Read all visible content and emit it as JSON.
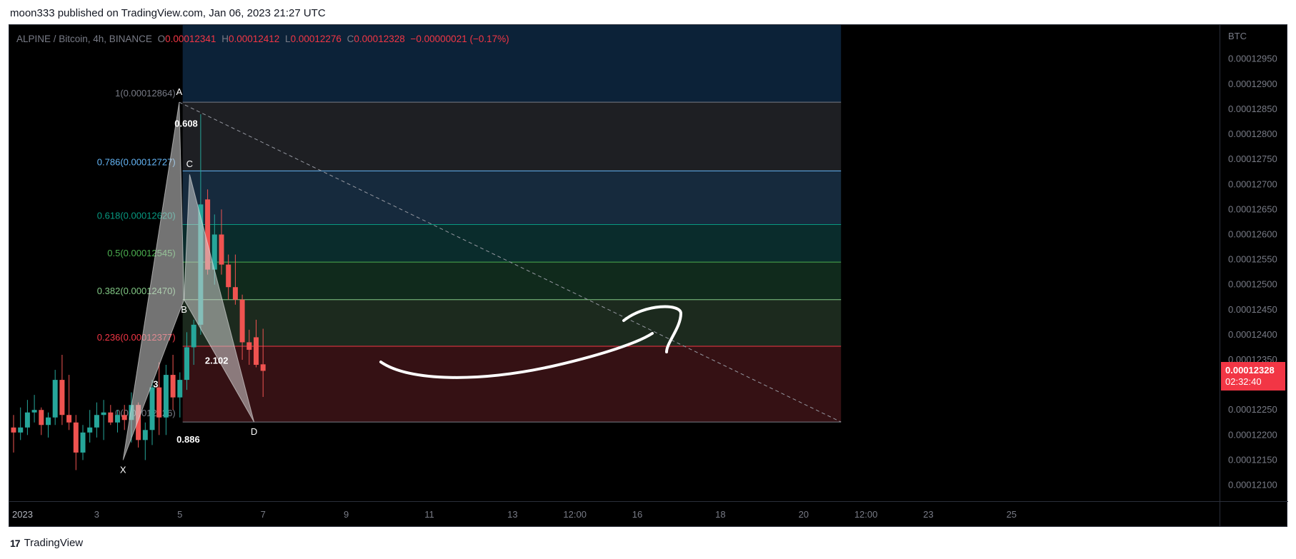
{
  "header": {
    "published_text": "moon333 published on TradingView.com, Jan 06, 2023 21:27 UTC"
  },
  "legend": {
    "symbol": "ALPINE / Bitcoin, 4h, BINANCE",
    "open_label": "O",
    "open": "0.00012341",
    "high_label": "H",
    "high": "0.00012412",
    "low_label": "L",
    "low": "0.00012276",
    "close_label": "C",
    "close": "0.00012328",
    "change": "−0.00000021 (−0.17%)"
  },
  "price_axis": {
    "unit": "BTC",
    "last_price": "0.00012328",
    "countdown": "02:32:40"
  },
  "footer": {
    "brand_name": "TradingView",
    "brand_mark": "17"
  },
  "colors": {
    "up": "#26a69a",
    "down": "#ef5350",
    "axis_text": "#787b86",
    "last_price_bg": "#f23645"
  },
  "chart_data": {
    "type": "candlestick",
    "timeframe": "4h",
    "ylim": [
      0.00012068,
      0.00013018
    ],
    "y_ticks": [
      "0.00012950",
      "0.00012900",
      "0.00012850",
      "0.00012800",
      "0.00012750",
      "0.00012700",
      "0.00012650",
      "0.00012600",
      "0.00012550",
      "0.00012500",
      "0.00012450",
      "0.00012400",
      "0.00012350",
      "0.00012250",
      "0.00012200",
      "0.00012150",
      "0.00012100"
    ],
    "x_ticks": [
      {
        "label": "2023",
        "t": 0
      },
      {
        "label": "3",
        "t": 12
      },
      {
        "label": "5",
        "t": 24
      },
      {
        "label": "7",
        "t": 36
      },
      {
        "label": "9",
        "t": 48
      },
      {
        "label": "11",
        "t": 60
      },
      {
        "label": "13",
        "t": 72
      },
      {
        "label": "12:00",
        "t": 81
      },
      {
        "label": "16",
        "t": 90
      },
      {
        "label": "18",
        "t": 102
      },
      {
        "label": "20",
        "t": 114
      },
      {
        "label": "12:00",
        "t": 123
      },
      {
        "label": "23",
        "t": 132
      },
      {
        "label": "25",
        "t": 144
      }
    ],
    "candles": [
      {
        "t": 0,
        "o": 0.00012215,
        "h": 0.0001224,
        "l": 0.00012165,
        "c": 0.00012205
      },
      {
        "t": 1,
        "o": 0.00012205,
        "h": 0.00012255,
        "l": 0.0001219,
        "c": 0.00012215
      },
      {
        "t": 2,
        "o": 0.00012215,
        "h": 0.0001227,
        "l": 0.000122,
        "c": 0.00012245
      },
      {
        "t": 3,
        "o": 0.00012245,
        "h": 0.0001228,
        "l": 0.00012225,
        "c": 0.0001225
      },
      {
        "t": 4,
        "o": 0.0001225,
        "h": 0.00012255,
        "l": 0.000122,
        "c": 0.0001222
      },
      {
        "t": 5,
        "o": 0.0001222,
        "h": 0.00012245,
        "l": 0.00012195,
        "c": 0.00012235
      },
      {
        "t": 6,
        "o": 0.00012235,
        "h": 0.0001233,
        "l": 0.0001222,
        "c": 0.0001231
      },
      {
        "t": 7,
        "o": 0.0001231,
        "h": 0.0001236,
        "l": 0.0001222,
        "c": 0.0001224
      },
      {
        "t": 8,
        "o": 0.0001224,
        "h": 0.0001232,
        "l": 0.0001221,
        "c": 0.00012225
      },
      {
        "t": 9,
        "o": 0.00012225,
        "h": 0.0001224,
        "l": 0.0001213,
        "c": 0.00012165
      },
      {
        "t": 10,
        "o": 0.00012165,
        "h": 0.0001222,
        "l": 0.0001215,
        "c": 0.00012205
      },
      {
        "t": 11,
        "o": 0.00012205,
        "h": 0.0001225,
        "l": 0.00012185,
        "c": 0.00012215
      },
      {
        "t": 12,
        "o": 0.00012215,
        "h": 0.00012265,
        "l": 0.00012195,
        "c": 0.0001224
      },
      {
        "t": 13,
        "o": 0.0001224,
        "h": 0.0001227,
        "l": 0.0001219,
        "c": 0.00012245
      },
      {
        "t": 14,
        "o": 0.00012245,
        "h": 0.0001226,
        "l": 0.0001222,
        "c": 0.00012225
      },
      {
        "t": 15,
        "o": 0.00012225,
        "h": 0.0001225,
        "l": 0.00012205,
        "c": 0.0001224
      },
      {
        "t": 16,
        "o": 0.0001224,
        "h": 0.0001226,
        "l": 0.0001221,
        "c": 0.0001223
      },
      {
        "t": 17,
        "o": 0.0001223,
        "h": 0.00012285,
        "l": 0.00012185,
        "c": 0.0001226
      },
      {
        "t": 18,
        "o": 0.0001226,
        "h": 0.00012265,
        "l": 0.00012175,
        "c": 0.0001219
      },
      {
        "t": 19,
        "o": 0.0001219,
        "h": 0.00012225,
        "l": 0.0001215,
        "c": 0.0001221
      },
      {
        "t": 20,
        "o": 0.0001221,
        "h": 0.0001231,
        "l": 0.0001218,
        "c": 0.00012295
      },
      {
        "t": 21,
        "o": 0.00012295,
        "h": 0.00012345,
        "l": 0.000122,
        "c": 0.00012235
      },
      {
        "t": 22,
        "o": 0.00012235,
        "h": 0.0001234,
        "l": 0.000122,
        "c": 0.0001232
      },
      {
        "t": 23,
        "o": 0.0001232,
        "h": 0.0001236,
        "l": 0.0001225,
        "c": 0.00012275
      },
      {
        "t": 24,
        "o": 0.00012275,
        "h": 0.00012325,
        "l": 0.00012235,
        "c": 0.0001231
      },
      {
        "t": 25,
        "o": 0.0001231,
        "h": 0.00012405,
        "l": 0.0001229,
        "c": 0.00012375
      },
      {
        "t": 26,
        "o": 0.00012375,
        "h": 0.0001243,
        "l": 0.0001234,
        "c": 0.0001242
      },
      {
        "t": 27,
        "o": 0.0001242,
        "h": 0.0001284,
        "l": 0.000124,
        "c": 0.0001266
      },
      {
        "t": 28,
        "o": 0.0001267,
        "h": 0.0001269,
        "l": 0.0001252,
        "c": 0.0001253
      },
      {
        "t": 29,
        "o": 0.0001253,
        "h": 0.0001264,
        "l": 0.000125,
        "c": 0.000126
      },
      {
        "t": 30,
        "o": 0.000126,
        "h": 0.0001265,
        "l": 0.0001252,
        "c": 0.0001254
      },
      {
        "t": 31,
        "o": 0.0001254,
        "h": 0.0001256,
        "l": 0.0001247,
        "c": 0.00012495
      },
      {
        "t": 32,
        "o": 0.00012495,
        "h": 0.0001256,
        "l": 0.0001246,
        "c": 0.0001247
      },
      {
        "t": 33,
        "o": 0.0001247,
        "h": 0.0001248,
        "l": 0.0001235,
        "c": 0.00012385
      },
      {
        "t": 34,
        "o": 0.00012385,
        "h": 0.0001241,
        "l": 0.0001234,
        "c": 0.0001237
      },
      {
        "t": 35,
        "o": 0.00012395,
        "h": 0.0001243,
        "l": 0.00012335,
        "c": 0.0001234
      },
      {
        "t": 36,
        "o": 0.00012341,
        "h": 0.00012412,
        "l": 0.00012276,
        "c": 0.00012328
      }
    ],
    "fib_levels": [
      {
        "label": "1(0.00012864)",
        "value": 0.00012864,
        "color": "#787b86"
      },
      {
        "label": "0.786(0.00012727)",
        "value": 0.00012727,
        "color": "#64b5f6"
      },
      {
        "label": "0.618(0.00012620)",
        "value": 0.0001262,
        "color": "#089981"
      },
      {
        "label": "0.5(0.00012545)",
        "value": 0.00012545,
        "color": "#4caf50"
      },
      {
        "label": "0.382(0.00012470)",
        "value": 0.0001247,
        "color": "#81c784"
      },
      {
        "label": "0.236(0.00012377)",
        "value": 0.00012377,
        "color": "#f23645"
      },
      {
        "label": "0(0.00012226)",
        "value": 0.00012226,
        "color": "#787b86"
      }
    ],
    "fib_start_t": 24.4,
    "fib_end_t": 119.4,
    "harmonic_points": [
      {
        "label": "X",
        "t": 15.8,
        "price": 0.0001215
      },
      {
        "label": "A",
        "t": 23.9,
        "price": 0.00012864
      },
      {
        "label": "B",
        "t": 24.6,
        "price": 0.0001247
      },
      {
        "label": "C",
        "t": 25.4,
        "price": 0.0001272
      },
      {
        "label": "D",
        "t": 34.7,
        "price": 0.00012226
      }
    ],
    "harmonic_ratios": [
      {
        "label": "0.608",
        "t": 24.9,
        "price": 0.00012815
      },
      {
        "label": "0.886",
        "t": 25.2,
        "price": 0.00012185
      },
      {
        "label": "2.102",
        "t": 29.3,
        "price": 0.00012342
      },
      {
        "label": "3",
        "t": 20.5,
        "price": 0.00012295
      }
    ],
    "trend_line": {
      "from": {
        "t": 23.9,
        "price": 0.00012864
      },
      "to": {
        "t": 119.4,
        "price": 0.00012226
      }
    }
  }
}
